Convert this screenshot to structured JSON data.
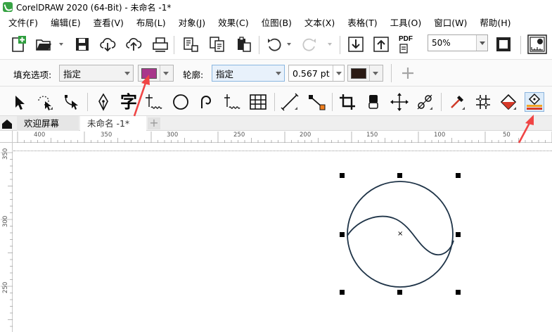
{
  "window": {
    "title": "CorelDRAW 2020 (64-Bit) - 未命名 -1*"
  },
  "menu": [
    "文件(F)",
    "编辑(E)",
    "查看(V)",
    "布局(L)",
    "对象(J)",
    "效果(C)",
    "位图(B)",
    "文本(X)",
    "表格(T)",
    "工具(O)",
    "窗口(W)",
    "帮助(H)"
  ],
  "standard_toolbar": {
    "zoom": "50%",
    "pdf_label": "PDF"
  },
  "property_bar": {
    "fill_label": "填充选项:",
    "fill_value": "指定",
    "fill_color": "#a8378b",
    "outline_label": "轮廓:",
    "outline_value": "指定",
    "outline_width": "0.567 pt",
    "outline_color": "#2a1a14"
  },
  "toolbox": {
    "text_tool_glyph": "字"
  },
  "tabs": {
    "welcome": "欢迎屏幕",
    "document": "未命名 -1*",
    "add": "+"
  },
  "ruler": {
    "h_labels": [
      "400",
      "350",
      "300",
      "250",
      "200",
      "150",
      "100",
      "50"
    ],
    "v_labels": [
      "350",
      "300",
      "250"
    ]
  },
  "canvas": {
    "center_mark": "×"
  },
  "colors": {
    "annotation_arrow": "#f04545",
    "circle_stroke": "#1f3448",
    "selection_tool_bg": "#dcebf9"
  }
}
